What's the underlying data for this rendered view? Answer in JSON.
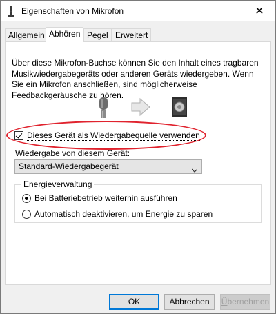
{
  "window": {
    "title": "Eigenschaften von Mikrofon",
    "close_glyph": "✕"
  },
  "tabs": [
    {
      "label": "Allgemein"
    },
    {
      "label": "Abhören"
    },
    {
      "label": "Pegel"
    },
    {
      "label": "Erweitert"
    }
  ],
  "active_tab": "Abhören",
  "description": "Über diese Mikrofon-Buchse können Sie den Inhalt eines tragbaren Musikwiedergabegeräts oder anderen Geräts wiedergeben. Wenn Sie ein Mikrofon anschließen, sind möglicherweise Feedbackgeräusche zu hören.",
  "illustration": {
    "icons": [
      "microphone-icon",
      "arrow-right-icon",
      "speaker-icon"
    ]
  },
  "listen_checkbox": {
    "label": "Dieses Gerät als Wiedergabequelle verwenden",
    "checked": true,
    "highlight_color": "#e0232e"
  },
  "playback": {
    "label": "Wiedergabe von diesem Gerät:",
    "selected": "Standard-Wiedergabegerät"
  },
  "power": {
    "title": "Energieverwaltung",
    "options": [
      {
        "label": "Bei Batteriebetrieb weiterhin ausführen",
        "selected": true
      },
      {
        "label": "Automatisch deaktivieren, um Energie zu sparen",
        "selected": false
      }
    ]
  },
  "buttons": {
    "ok": "OK",
    "cancel": "Abbrechen",
    "apply_first": "Ü",
    "apply_rest": "bernehmen"
  },
  "colors": {
    "accent": "#0078d7",
    "panel_bg": "#ffffff",
    "window_bg": "#f0f0f0"
  }
}
